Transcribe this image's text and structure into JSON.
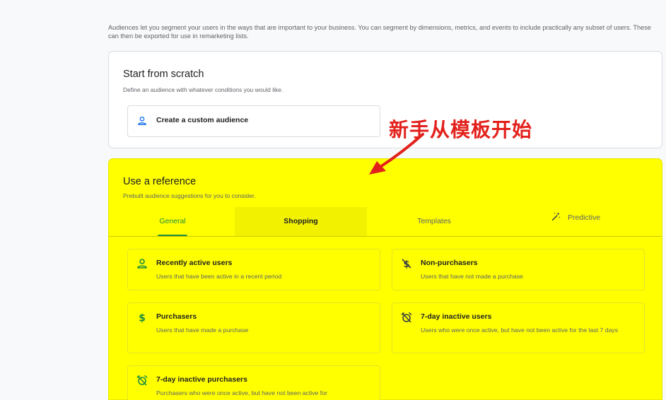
{
  "intro_text": "Audiences let you segment your users in the ways that are important to your business. You can segment by dimensions, metrics, and events to include practically any subset of users. These can then be exported for use in remarketing lists.",
  "scratch": {
    "title": "Start from scratch",
    "subtitle": "Define an audience with whatever conditions you would like.",
    "custom_button_label": "Create a custom audience",
    "custom_button_icon": "person-icon"
  },
  "annotation": {
    "text": "新手从模板开始",
    "color": "#e3211c"
  },
  "reference": {
    "title": "Use a reference",
    "subtitle": "Prebuilt audience suggestions for you to consider.",
    "highlight_color": "#ffff00",
    "tabs": [
      {
        "label": "General",
        "active": true
      },
      {
        "label": "Shopping",
        "active": false
      },
      {
        "label": "Templates",
        "active": false
      },
      {
        "label": "Predictive",
        "active": false,
        "icon": "magic-wand-icon"
      }
    ],
    "options": [
      {
        "title": "Recently active users",
        "description": "Users that have been active in a recent period",
        "icon": "person-icon"
      },
      {
        "title": "Non-purchasers",
        "description": "Users that have not made a purchase",
        "icon": "no-dollar-icon"
      },
      {
        "title": "Purchasers",
        "description": "Users that have made a purchase",
        "icon": "dollar-icon"
      },
      {
        "title": "7-day inactive users",
        "description": "Users who were once active, but have not been active for the last 7 days",
        "icon": "alarm-off-icon"
      },
      {
        "title": "7-day inactive purchasers",
        "description": "Purchasers who were once active, but have not been active for",
        "icon": "alarm-off-icon"
      }
    ]
  },
  "colors": {
    "accent_green": "#1e8e3e",
    "icon_blue": "#1a73e8"
  }
}
